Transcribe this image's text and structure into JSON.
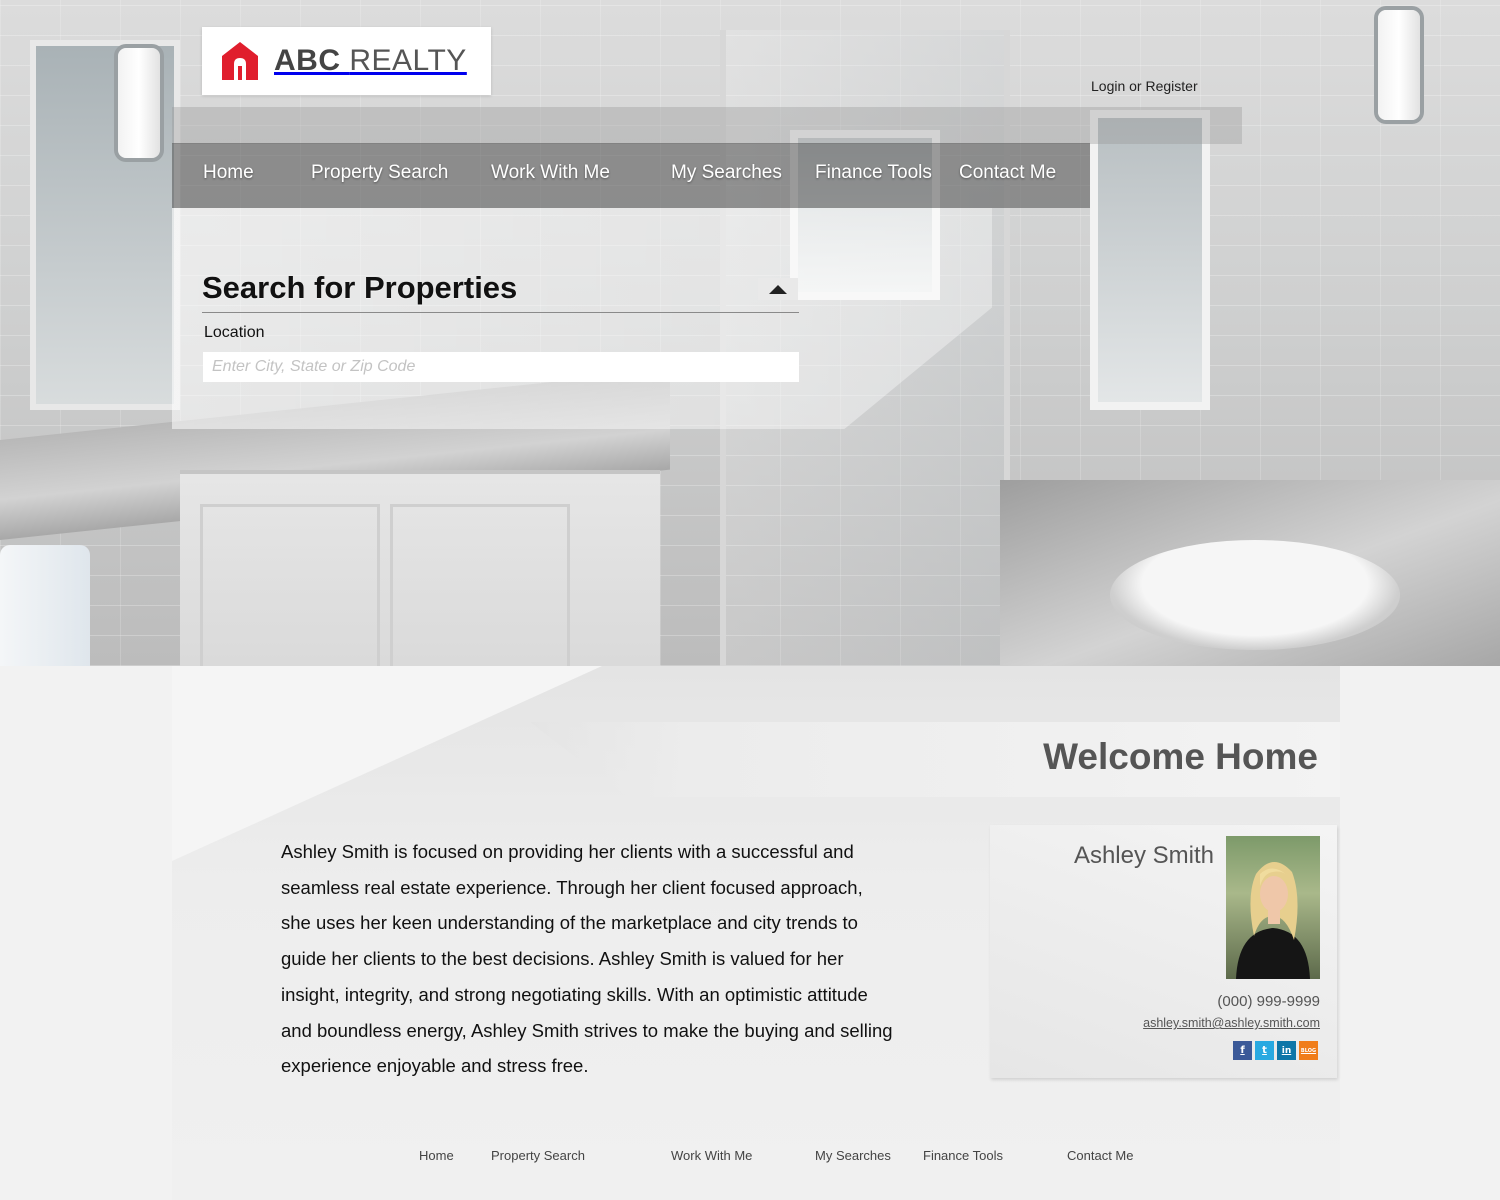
{
  "brand": {
    "name_bold": "ABC",
    "name_light": "REALTY",
    "logo_icon": "house-icon",
    "accent": "#e01e2d"
  },
  "header": {
    "login_label": "Login or Register"
  },
  "nav": {
    "items": [
      {
        "label": "Home"
      },
      {
        "label": "Property Search"
      },
      {
        "label": "Work With Me"
      },
      {
        "label": "My Searches"
      },
      {
        "label": "Finance Tools"
      },
      {
        "label": "Contact Me"
      }
    ]
  },
  "search": {
    "title": "Search for Properties",
    "location_label": "Location",
    "location_placeholder": "Enter City, State or Zip Code",
    "location_value": "",
    "collapse_icon": "triangle-up-icon"
  },
  "welcome": {
    "title": "Welcome Home",
    "bio": "Ashley Smith is focused on providing her clients with a successful and seamless real estate experience. Through her client focused approach, she uses her keen understanding of the marketplace and city trends to guide her clients to the best decisions. Ashley Smith is valued for her insight, integrity, and strong negotiating skills. With an optimistic attitude and boundless energy, Ashley Smith strives to make the buying and selling experience enjoyable and stress free."
  },
  "agent": {
    "name": "Ashley Smith",
    "phone": "(000) 999-9999",
    "email": "ashley.smith@ashley.smith.com",
    "social": [
      {
        "icon": "facebook-icon",
        "glyph": "f",
        "color": "#3b5998"
      },
      {
        "icon": "twitter-icon",
        "glyph": "t",
        "color": "#29a9e1"
      },
      {
        "icon": "linkedin-icon",
        "glyph": "in",
        "color": "#0e76a8"
      },
      {
        "icon": "blog-icon",
        "glyph": "BLOG",
        "color": "#f07d1a"
      }
    ]
  },
  "footer": {
    "items": [
      {
        "label": "Home"
      },
      {
        "label": "Property Search"
      },
      {
        "label": "Work With Me"
      },
      {
        "label": "My Searches"
      },
      {
        "label": "Finance Tools"
      },
      {
        "label": "Contact Me"
      }
    ]
  }
}
